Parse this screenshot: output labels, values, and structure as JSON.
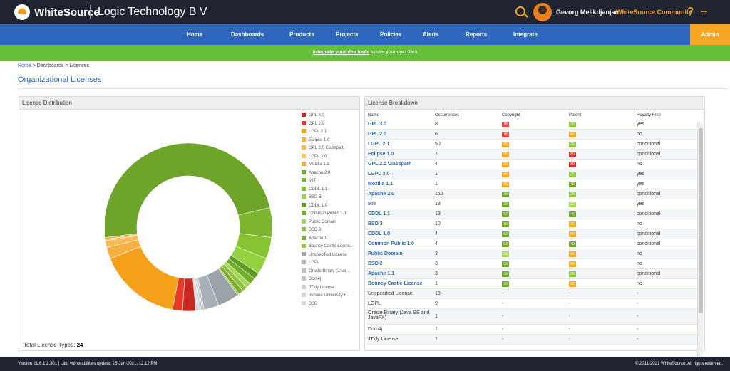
{
  "header": {
    "brand": "WhiteSource",
    "org": "Logic Technology B V",
    "username": "Gevorg Melikdjanjan",
    "community_link": "WhiteSource Community",
    "help_symbol": "?",
    "logout_symbol": "→",
    "icons": [
      "whitesource-logo-icon",
      "search-icon",
      "avatar",
      "help-icon",
      "logout-icon"
    ]
  },
  "nav": {
    "items": [
      "Home",
      "Dashboards",
      "Products",
      "Projects",
      "Policies",
      "Alerts",
      "Reports",
      "Integrate"
    ],
    "admin": "Admin"
  },
  "banner": {
    "link": "Integrate your dev tools",
    "text": " to see your own data"
  },
  "breadcrumb": {
    "home": "Home",
    "sep": " > ",
    "dashboards": "Dashboards",
    "current": "Licenses"
  },
  "page_title": "Organizational Licenses",
  "distribution": {
    "title": "License Distribution",
    "total_label": "Total License Types: ",
    "total_value": "24",
    "legend": [
      {
        "label": "GPL 3.0",
        "color": "#c8281f"
      },
      {
        "label": "GPL 2.0",
        "color": "#e63a25"
      },
      {
        "label": "LGPL 2.1",
        "color": "#f5a01a"
      },
      {
        "label": "Eclipse 1.0",
        "color": "#f7b041"
      },
      {
        "label": "GPL 2.0 Classpath",
        "color": "#f8bb58"
      },
      {
        "label": "LGPL 3.0",
        "color": "#f9c36e"
      },
      {
        "label": "Mozilla 1.1",
        "color": "#f3a93a"
      },
      {
        "label": "Apache 2.0",
        "color": "#6fa42b"
      },
      {
        "label": "MIT",
        "color": "#7db52f"
      },
      {
        "label": "CDDL 1.1",
        "color": "#86c433"
      },
      {
        "label": "BSD 3",
        "color": "#94d13f"
      },
      {
        "label": "CDDL 1.0",
        "color": "#5e9a23"
      },
      {
        "label": "Common Public 1.0",
        "color": "#72ad2a"
      },
      {
        "label": "Public Domain",
        "color": "#a4d85a"
      },
      {
        "label": "BSD 2",
        "color": "#8ebf3a"
      },
      {
        "label": "Apache 1.1",
        "color": "#7caa33"
      },
      {
        "label": "Bouncy Castle Licens..",
        "color": "#9bc84a"
      },
      {
        "label": "Unspecified License",
        "color": "#9aa3aa"
      },
      {
        "label": "LGPL",
        "color": "#a8b0b6"
      },
      {
        "label": "Oracle Binary (Java ..",
        "color": "#b4bbc0"
      },
      {
        "label": "Dom4j",
        "color": "#bfc5ca"
      },
      {
        "label": "JTidy License",
        "color": "#c8cdd1"
      },
      {
        "label": "Indiana University E..",
        "color": "#d0d4d8"
      },
      {
        "label": "BSD",
        "color": "#d7dbde"
      }
    ],
    "slices": [
      {
        "label": "Apache 2.0",
        "value": 152,
        "color": "#6fa42b"
      },
      {
        "label": "MIT",
        "value": 18,
        "color": "#7db52f"
      },
      {
        "label": "CDDL 1.1",
        "value": 13,
        "color": "#86c433"
      },
      {
        "label": "BSD 3",
        "value": 10,
        "color": "#94d13f"
      },
      {
        "label": "CDDL 1.0",
        "value": 4,
        "color": "#5e9a23"
      },
      {
        "label": "Common Public 1.0",
        "value": 4,
        "color": "#72ad2a"
      },
      {
        "label": "Public Domain",
        "value": 3,
        "color": "#a4d85a"
      },
      {
        "label": "BSD 2",
        "value": 3,
        "color": "#8ebf3a"
      },
      {
        "label": "Apache 1.1",
        "value": 3,
        "color": "#7caa33"
      },
      {
        "label": "Bouncy Castle Licens..",
        "value": 1,
        "color": "#9bc84a"
      },
      {
        "label": "Unspecified License",
        "value": 13,
        "color": "#9aa3aa"
      },
      {
        "label": "LGPL",
        "value": 9,
        "color": "#a8b0b6"
      },
      {
        "label": "Oracle Binary (Java ..",
        "value": 1,
        "color": "#b4bbc0"
      },
      {
        "label": "Dom4j",
        "value": 1,
        "color": "#bfc5ca"
      },
      {
        "label": "JTidy License",
        "value": 1,
        "color": "#c8cdd1"
      },
      {
        "label": "Indiana University E..",
        "value": 1,
        "color": "#d0d4d8"
      },
      {
        "label": "BSD",
        "value": 1,
        "color": "#d7dbde"
      },
      {
        "label": "GPL 3.0",
        "value": 8,
        "color": "#c8281f"
      },
      {
        "label": "GPL 2.0",
        "value": 6,
        "color": "#e63a25"
      },
      {
        "label": "LGPL 2.1",
        "value": 50,
        "color": "#f5a01a"
      },
      {
        "label": "Eclipse 1.0",
        "value": 7,
        "color": "#f7b041"
      },
      {
        "label": "GPL 2.0 Classpath",
        "value": 4,
        "color": "#f8bb58"
      },
      {
        "label": "LGPL 3.0",
        "value": 1,
        "color": "#f9c36e"
      },
      {
        "label": "Mozilla 1.1",
        "value": 1,
        "color": "#f3a93a"
      }
    ]
  },
  "breakdown": {
    "title": "License Breakdown",
    "columns": [
      "Name",
      "Occurrences",
      "Copyright",
      "Patent",
      "Royalty Free"
    ],
    "rows": [
      {
        "name": "GPL 3.0",
        "occ": "8",
        "copyright": "78",
        "cc": "#e34a3a",
        "patent": "26",
        "pc": "#8dc63f",
        "royalty": "yes",
        "link": true
      },
      {
        "name": "GPL 2.0",
        "occ": "6",
        "copyright": "78",
        "cc": "#e34a3a",
        "patent": "60",
        "pc": "#f5a623",
        "royalty": "no",
        "link": true
      },
      {
        "name": "LGPL 2.1",
        "occ": "50",
        "copyright": "65",
        "cc": "#f5a623",
        "patent": "26",
        "pc": "#8dc63f",
        "royalty": "conditional",
        "link": true
      },
      {
        "name": "Eclipse 1.0",
        "occ": "7",
        "copyright": "65",
        "cc": "#f5a623",
        "patent": "80",
        "pc": "#d0312d",
        "royalty": "conditional",
        "link": true
      },
      {
        "name": "GPL 2.0 Classpath",
        "occ": "4",
        "copyright": "65",
        "cc": "#f5a623",
        "patent": "80",
        "pc": "#d0312d",
        "royalty": "no",
        "link": true
      },
      {
        "name": "LGPL 3.0",
        "occ": "1",
        "copyright": "65",
        "cc": "#f5a623",
        "patent": "26",
        "pc": "#8dc63f",
        "royalty": "yes",
        "link": true
      },
      {
        "name": "Mozilla 1.1",
        "occ": "1",
        "copyright": "65",
        "cc": "#f5a623",
        "patent": "40",
        "pc": "#6fa42b",
        "royalty": "yes",
        "link": true
      },
      {
        "name": "Apache 2.0",
        "occ": "152",
        "copyright": "39",
        "cc": "#6fa42b",
        "patent": "26",
        "pc": "#8dc63f",
        "royalty": "conditional",
        "link": true
      },
      {
        "name": "MIT",
        "occ": "18",
        "copyright": "39",
        "cc": "#6fa42b",
        "patent": "20",
        "pc": "#a4d85a",
        "royalty": "yes",
        "link": true
      },
      {
        "name": "CDDL 1.1",
        "occ": "13",
        "copyright": "52",
        "cc": "#6fa42b",
        "patent": "40",
        "pc": "#6fa42b",
        "royalty": "conditional",
        "link": true
      },
      {
        "name": "BSD 3",
        "occ": "10",
        "copyright": "39",
        "cc": "#6fa42b",
        "patent": "60",
        "pc": "#f5a623",
        "royalty": "no",
        "link": true
      },
      {
        "name": "CDDL 1.0",
        "occ": "4",
        "copyright": "52",
        "cc": "#6fa42b",
        "patent": "60",
        "pc": "#f5a623",
        "royalty": "conditional",
        "link": true
      },
      {
        "name": "Common Public 1.0",
        "occ": "4",
        "copyright": "52",
        "cc": "#6fa42b",
        "patent": "40",
        "pc": "#6fa42b",
        "royalty": "conditional",
        "link": true
      },
      {
        "name": "Public Domain",
        "occ": "3",
        "copyright": "13",
        "cc": "#a4d85a",
        "patent": "60",
        "pc": "#f5a623",
        "royalty": "no",
        "link": true
      },
      {
        "name": "BSD 2",
        "occ": "3",
        "copyright": "39",
        "cc": "#6fa42b",
        "patent": "60",
        "pc": "#f5a623",
        "royalty": "no",
        "link": true
      },
      {
        "name": "Apache 1.1",
        "occ": "3",
        "copyright": "39",
        "cc": "#6fa42b",
        "patent": "26",
        "pc": "#8dc63f",
        "royalty": "conditional",
        "link": true
      },
      {
        "name": "Bouncy Castle License",
        "occ": "1",
        "copyright": "39",
        "cc": "#6fa42b",
        "patent": "60",
        "pc": "#f5a623",
        "royalty": "no",
        "link": true
      },
      {
        "name": "Unspecified License",
        "occ": "13",
        "copyright": "-",
        "patent": "-",
        "royalty": "-",
        "link": false
      },
      {
        "name": "LGPL",
        "occ": "9",
        "copyright": "-",
        "patent": "-",
        "royalty": "-",
        "link": false
      },
      {
        "name": "Oracle Binary (Java SE and JavaFX)",
        "occ": "1",
        "copyright": "-",
        "patent": "-",
        "royalty": "-",
        "link": false
      },
      {
        "name": "Dom4j",
        "occ": "1",
        "copyright": "-",
        "patent": "-",
        "royalty": "-",
        "link": false
      },
      {
        "name": "JTidy License",
        "occ": "1",
        "copyright": "-",
        "patent": "-",
        "royalty": "-",
        "link": false
      }
    ]
  },
  "footer": {
    "version": "Version 21.6.1.2.301 | Last vulnerabilities update: 25-Jun-2021, 12:12 PM",
    "copyright": "© 2011-2021 WhiteSource. All rights reserved."
  }
}
